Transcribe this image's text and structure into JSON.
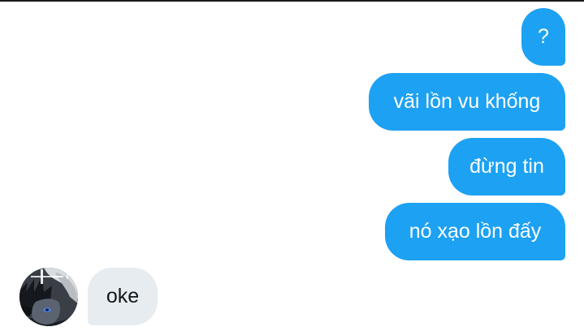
{
  "conversation": {
    "messages": [
      {
        "direction": "sent",
        "text": "?"
      },
      {
        "direction": "sent",
        "text": "vãi lồn vu khống"
      },
      {
        "direction": "sent",
        "text": "đừng tin"
      },
      {
        "direction": "sent",
        "text": "nó xạo lồn đấy"
      },
      {
        "direction": "received",
        "text": "oke"
      }
    ],
    "avatar_icon": "profile-picture-anime-character"
  },
  "colors": {
    "sent_bubble": "#1da1f2",
    "sent_text": "#ffffff",
    "received_bubble": "#e6ecf0",
    "received_text": "#14171a"
  }
}
